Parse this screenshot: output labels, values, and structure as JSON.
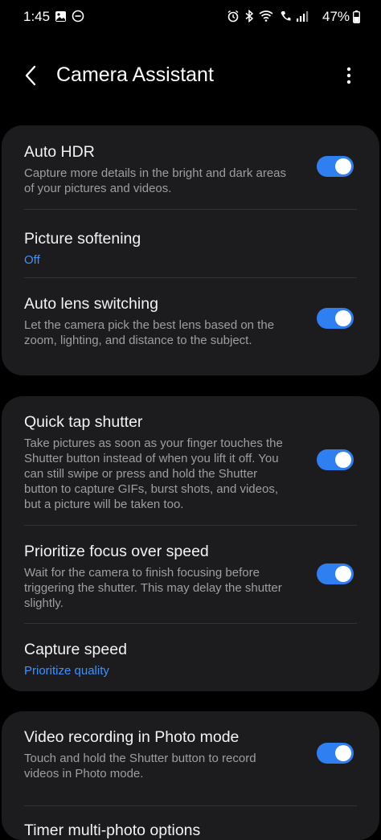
{
  "status_bar": {
    "time": "1:45",
    "battery_percent": "47%"
  },
  "header": {
    "title": "Camera Assistant"
  },
  "sections": [
    {
      "items": [
        {
          "title": "Auto HDR",
          "description": "Capture more details in the bright and dark areas of your pictures and videos.",
          "toggle_on": true
        },
        {
          "title": "Picture softening",
          "value": "Off"
        },
        {
          "title": "Auto lens switching",
          "description": "Let the camera pick the best lens based on the zoom, lighting, and distance to the subject.",
          "toggle_on": true
        }
      ]
    },
    {
      "items": [
        {
          "title": "Quick tap shutter",
          "description": "Take pictures as soon as your finger touches the Shutter button instead of when you lift it off. You can still swipe or press and hold the Shutter button to capture GIFs, burst shots, and videos, but a picture will be taken too.",
          "toggle_on": true
        },
        {
          "title": "Prioritize focus over speed",
          "description": "Wait for the camera to finish focusing before triggering the shutter. This may delay the shutter slightly.",
          "toggle_on": true
        },
        {
          "title": "Capture speed",
          "value": "Prioritize quality"
        }
      ]
    },
    {
      "items": [
        {
          "title": "Video recording in Photo mode",
          "description": "Touch and hold the Shutter button to record videos in Photo mode.",
          "toggle_on": true
        },
        {
          "title": "Timer multi-photo options"
        }
      ]
    }
  ],
  "colors": {
    "background": "#000000",
    "card": "#1c1c1e",
    "accent": "#3e91ff",
    "toggle_on": "#2f7ff0"
  }
}
